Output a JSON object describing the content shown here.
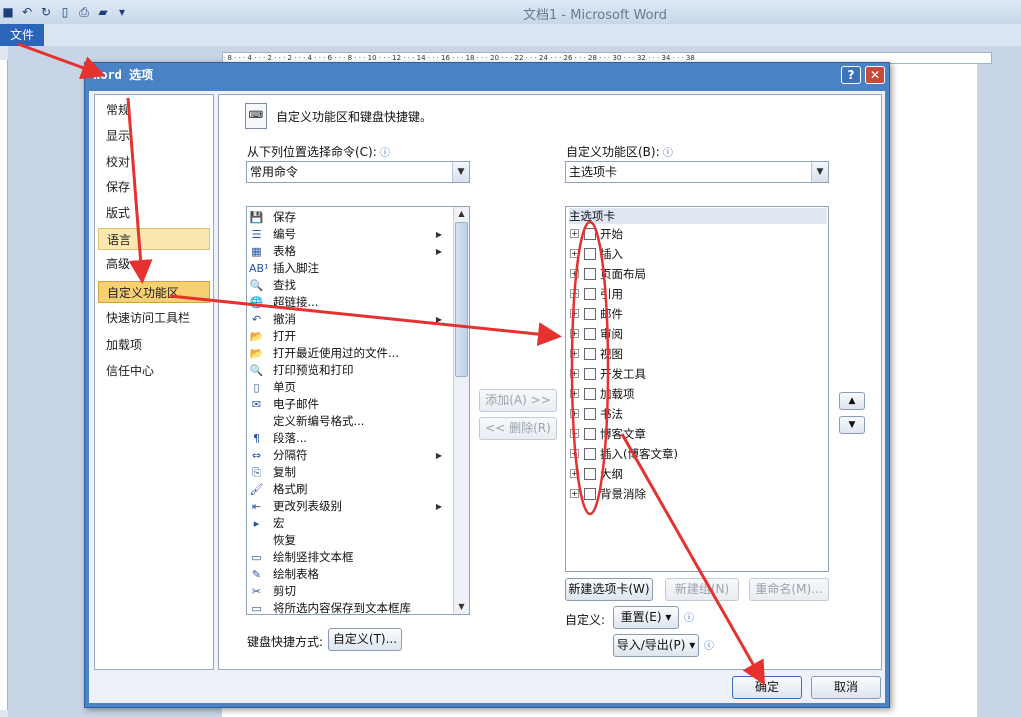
{
  "window": {
    "title": "文档1 - Microsoft Word"
  },
  "file_tab": {
    "label": "文件"
  },
  "ruler": {
    "marks": "· 8 · · · 4 · · · 2 · · · 2 · · · 4 · · · 6 · · · 8 · · · 10 · · · 12 · · · 14 · · · 16 · · · 18 · · · 20 · · · 22 · · · 24 · · · 26 · · · 28 · · · 30 · · · 32 · · · 34 · · · 38"
  },
  "dialog": {
    "title": "Word 选项",
    "help_label": "?",
    "close_label": "✕",
    "nav": [
      {
        "label": "常规"
      },
      {
        "label": "显示"
      },
      {
        "label": "校对"
      },
      {
        "label": "保存"
      },
      {
        "label": "版式"
      },
      {
        "label": "语言"
      },
      {
        "label": "高级"
      },
      {
        "label": "自定义功能区"
      },
      {
        "label": "快速访问工具栏"
      },
      {
        "label": "加载项"
      },
      {
        "label": "信任中心"
      }
    ],
    "header": "自定义功能区和键盘快捷键。",
    "left_label": "从下列位置选择命令(C):",
    "left_combo": "常用命令",
    "right_label": "自定义功能区(B):",
    "right_combo": "主选项卡",
    "commands": [
      {
        "label": "保存",
        "sub": ""
      },
      {
        "label": "编号",
        "sub": "▶"
      },
      {
        "label": "表格",
        "sub": "▶"
      },
      {
        "label": "插入脚注",
        "sub": ""
      },
      {
        "label": "查找",
        "sub": ""
      },
      {
        "label": "超链接...",
        "sub": ""
      },
      {
        "label": "撤消",
        "sub": "▶"
      },
      {
        "label": "打开",
        "sub": ""
      },
      {
        "label": "打开最近使用过的文件...",
        "sub": ""
      },
      {
        "label": "打印预览和打印",
        "sub": ""
      },
      {
        "label": "单页",
        "sub": ""
      },
      {
        "label": "电子邮件",
        "sub": ""
      },
      {
        "label": "定义新编号格式...",
        "sub": ""
      },
      {
        "label": "段落...",
        "sub": ""
      },
      {
        "label": "分隔符",
        "sub": "▶"
      },
      {
        "label": "复制",
        "sub": ""
      },
      {
        "label": "格式刷",
        "sub": ""
      },
      {
        "label": "更改列表级别",
        "sub": "▶"
      },
      {
        "label": "宏",
        "sub": ""
      },
      {
        "label": "恢复",
        "sub": ""
      },
      {
        "label": "绘制竖排文本框",
        "sub": ""
      },
      {
        "label": "绘制表格",
        "sub": ""
      },
      {
        "label": "剪切",
        "sub": ""
      },
      {
        "label": "将所选内容保存到文本框库",
        "sub": ""
      }
    ],
    "command_icons": [
      "💾",
      "☰",
      "▦",
      "AB¹",
      "🔍",
      "🌐",
      "↶",
      "📂",
      "📂",
      "🔍",
      "▯",
      "✉",
      "",
      "¶",
      "⇔",
      "⎘",
      "🖌",
      "⇤",
      "▸",
      "",
      "▭",
      "✎",
      "✂",
      "▭"
    ],
    "tree_root": "主选项卡",
    "tabs": [
      {
        "label": "开始"
      },
      {
        "label": "插入"
      },
      {
        "label": "页面布局"
      },
      {
        "label": "引用"
      },
      {
        "label": "邮件"
      },
      {
        "label": "审阅"
      },
      {
        "label": "视图"
      },
      {
        "label": "开发工具"
      },
      {
        "label": "加载项"
      },
      {
        "label": "书法"
      },
      {
        "label": "博客文章"
      },
      {
        "label": "插入(博客文章)"
      },
      {
        "label": "大纲"
      },
      {
        "label": "背景消除"
      }
    ],
    "add_button": "添加(A) >>",
    "remove_button": "<< 删除(R)",
    "new_tab_button": "新建选项卡(W)",
    "new_group_button": "新建组(N)",
    "rename_button": "重命名(M)...",
    "customize_label": "自定义:",
    "reset_button": "重置(E) ▾",
    "import_export_button": "导入/导出(P) ▾",
    "keyboard_label": "键盘快捷方式:",
    "keyboard_button": "自定义(T)...",
    "ok_button": "确定",
    "cancel_button": "取消",
    "up_arrow": "▲",
    "down_arrow": "▼"
  }
}
